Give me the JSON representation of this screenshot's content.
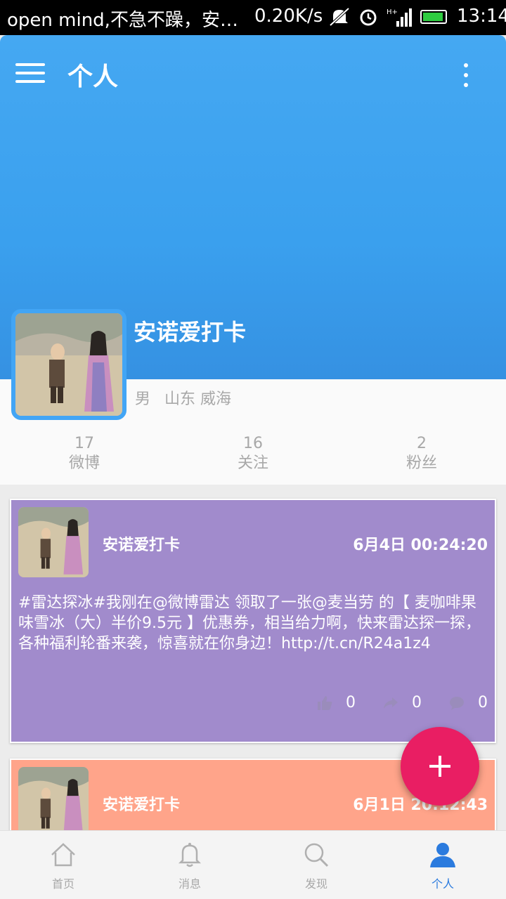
{
  "status_bar": {
    "notification": "open mind,不急不躁，安…",
    "speed": "0.20K/s",
    "time": "13:14"
  },
  "header": {
    "title": "个人",
    "menu_icon": "hamburger-menu-icon",
    "more_icon": "more-vertical-icon"
  },
  "profile": {
    "name": "安诺爱打卡",
    "gender": "男",
    "location": "山东 威海",
    "stats": [
      {
        "count": "17",
        "label": "微博"
      },
      {
        "count": "16",
        "label": "关注"
      },
      {
        "count": "2",
        "label": "粉丝"
      }
    ]
  },
  "posts": [
    {
      "user": "安诺爱打卡",
      "time": "6月4日 00:24:20",
      "text": "#雷达探冰#我刚在@微博雷达 领取了一张@麦当劳 的【 麦咖啡果味雪冰（大）半价9.5元 】优惠券，相当给力啊，快来雷达探一探，各种福利轮番来袭，惊喜就在你身边！http://t.cn/R24a1z4",
      "likes": "0",
      "reposts": "0",
      "comments": "0",
      "color": "#a18bcc"
    },
    {
      "user": "安诺爱打卡",
      "time": "6月1日 20:12:43",
      "color": "#ffa48a"
    }
  ],
  "fab": {
    "icon": "plus-icon",
    "color": "#e91e63"
  },
  "bottom_nav": [
    {
      "label": "首页",
      "icon": "home-icon"
    },
    {
      "label": "消息",
      "icon": "bell-icon"
    },
    {
      "label": "发现",
      "icon": "search-icon"
    },
    {
      "label": "个人",
      "icon": "person-icon",
      "active": true
    }
  ],
  "colors": {
    "primary": "#42a5f5",
    "accent": "#e91e63",
    "active_nav": "#2b7bde"
  }
}
